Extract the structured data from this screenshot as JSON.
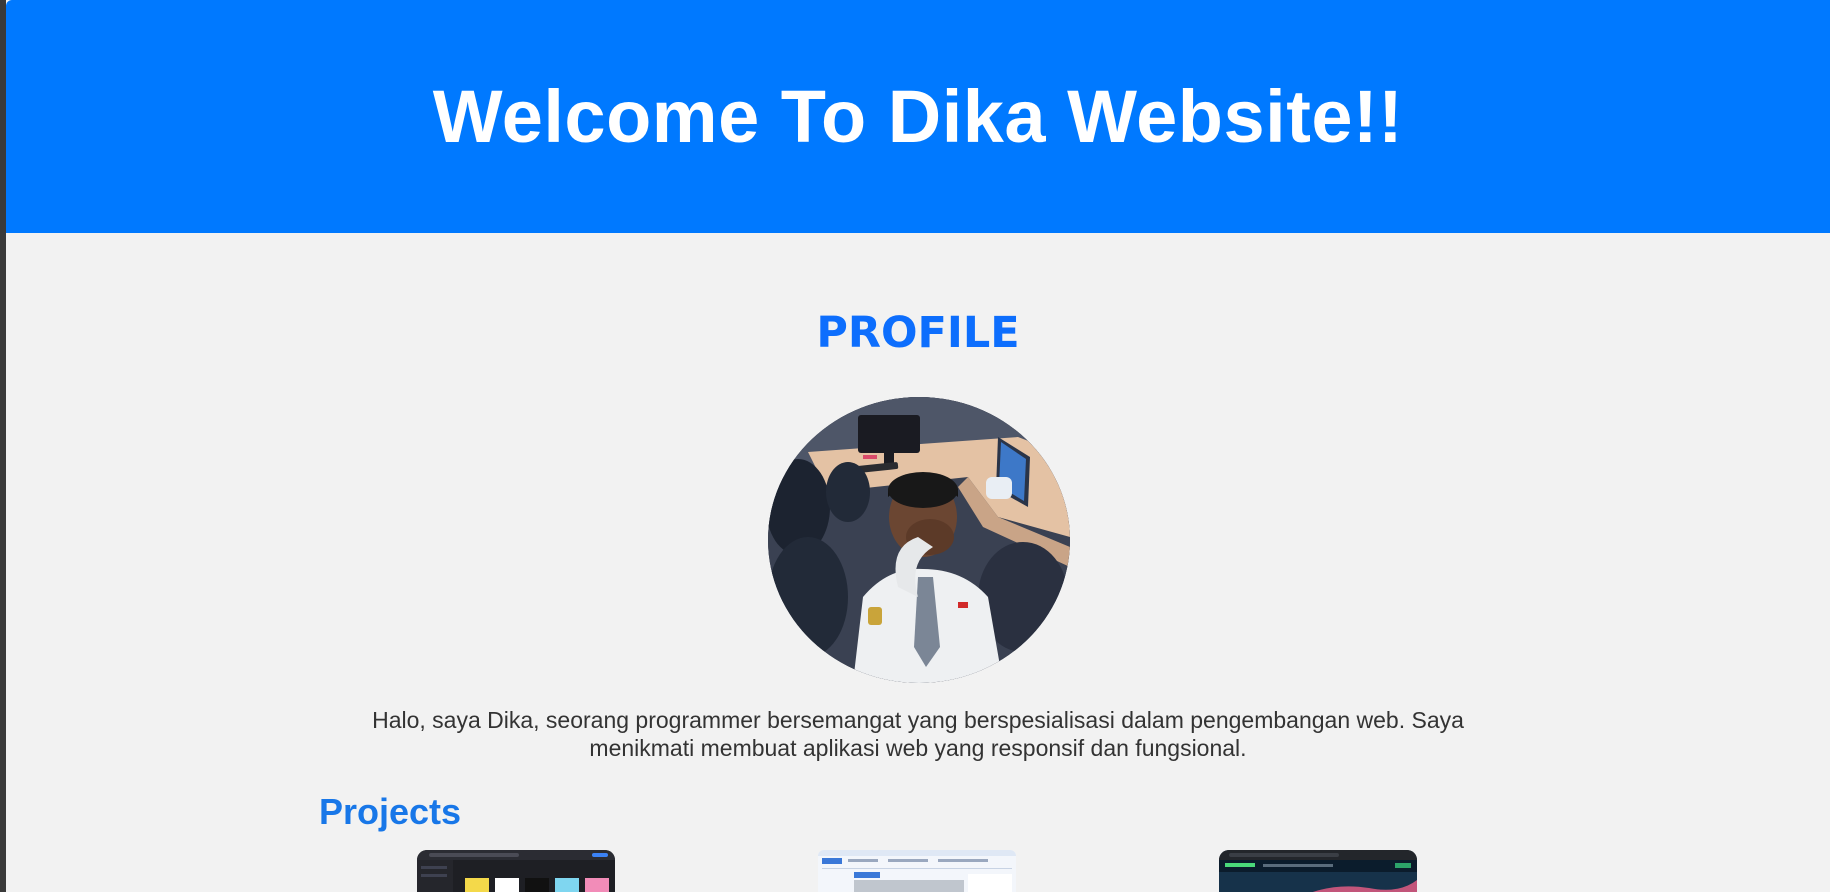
{
  "header": {
    "title": "Welcome To Dika Website!!",
    "background_color": "#0079ff"
  },
  "profile": {
    "heading": "PROFILE",
    "heading_color": "#0d6efd",
    "photo": "profile-photo",
    "bio": "Halo, saya Dika, seorang programmer bersemangat yang berspesialisasi dalam pengembangan web. Saya menikmati membuat aplikasi web yang responsif dan fungsional."
  },
  "projects": {
    "heading": "Projects",
    "items": [
      {
        "thumbnail": "project-1-screenshot"
      },
      {
        "thumbnail": "project-2-screenshot"
      },
      {
        "thumbnail": "project-3-screenshot"
      }
    ]
  },
  "colors": {
    "page_background": "#f2f2f2",
    "text": "#333333",
    "accent": "#1877e8"
  }
}
